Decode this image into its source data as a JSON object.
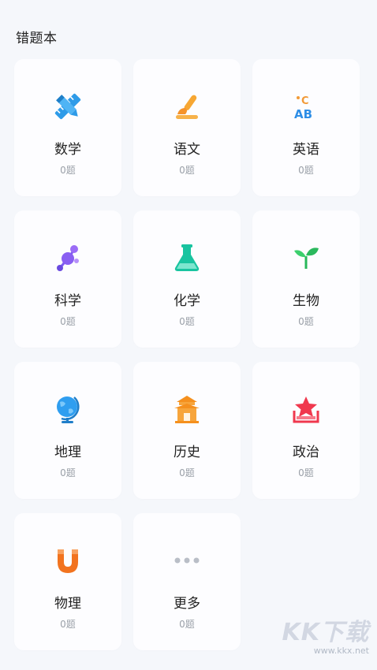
{
  "page_title": "错题本",
  "subjects": [
    {
      "name": "数学",
      "count": "0题",
      "icon": "ruler-pencil-icon"
    },
    {
      "name": "语文",
      "count": "0题",
      "icon": "brush-icon"
    },
    {
      "name": "英语",
      "count": "0题",
      "icon": "abc-icon",
      "icon_text": {
        "top": "C",
        "bottom": "AB"
      }
    },
    {
      "name": "科学",
      "count": "0题",
      "icon": "molecule-icon"
    },
    {
      "name": "化学",
      "count": "0题",
      "icon": "flask-icon"
    },
    {
      "name": "生物",
      "count": "0题",
      "icon": "sprout-icon"
    },
    {
      "name": "地理",
      "count": "0题",
      "icon": "globe-icon"
    },
    {
      "name": "历史",
      "count": "0题",
      "icon": "pavilion-icon"
    },
    {
      "name": "政治",
      "count": "0题",
      "icon": "star-badge-icon"
    },
    {
      "name": "物理",
      "count": "0题",
      "icon": "magnet-icon"
    },
    {
      "name": "更多",
      "count": "0题",
      "icon": "more-dots-icon"
    }
  ],
  "watermark": {
    "main": "KK下载",
    "sub": "www.kkx.net"
  }
}
